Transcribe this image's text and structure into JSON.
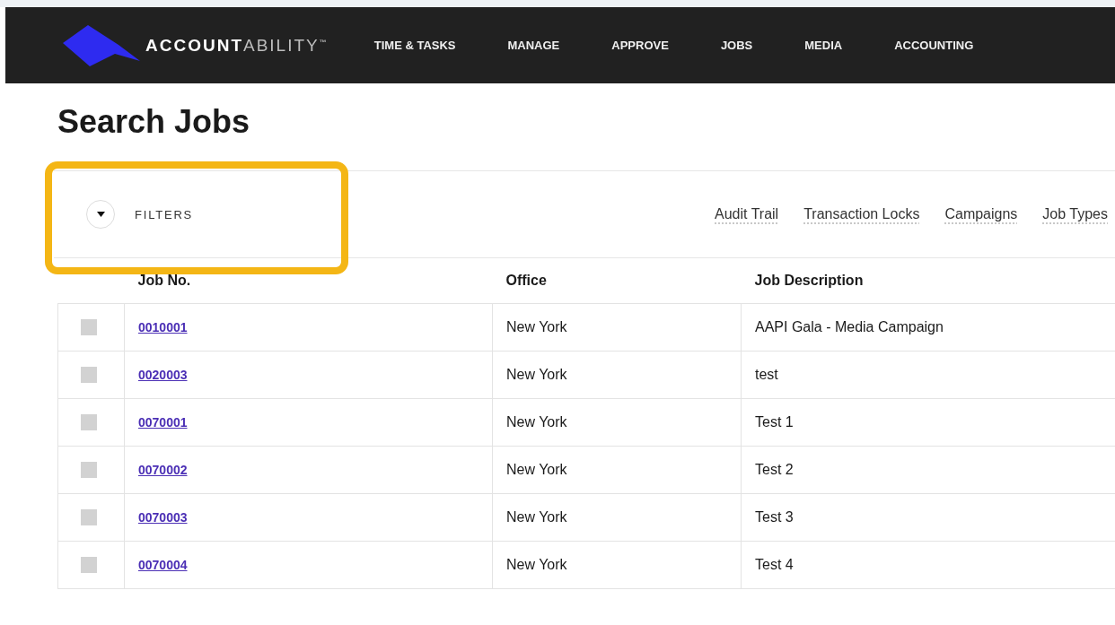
{
  "brand": {
    "strong": "ACCOUNT",
    "light": "ABILITY",
    "mark": "™"
  },
  "nav": [
    {
      "label": "TIME & TASKS"
    },
    {
      "label": "MANAGE"
    },
    {
      "label": "APPROVE"
    },
    {
      "label": "JOBS"
    },
    {
      "label": "MEDIA"
    },
    {
      "label": "ACCOUNTING"
    }
  ],
  "title": "Search Jobs",
  "filters": {
    "label": "FILTERS",
    "expanded": false,
    "highlighted": true
  },
  "links": [
    "Audit Trail",
    "Transaction Locks",
    "Campaigns",
    "Job Types"
  ],
  "table": {
    "columns": [
      "Job No.",
      "Office",
      "Job Description"
    ],
    "rows": [
      {
        "checked": false,
        "job_no": "0010001",
        "office": "New York",
        "description": "AAPI Gala - Media Campaign"
      },
      {
        "checked": false,
        "job_no": "0020003",
        "office": "New York",
        "description": "test"
      },
      {
        "checked": false,
        "job_no": "0070001",
        "office": "New York",
        "description": "Test 1"
      },
      {
        "checked": false,
        "job_no": "0070002",
        "office": "New York",
        "description": "Test 2"
      },
      {
        "checked": false,
        "job_no": "0070003",
        "office": "New York",
        "description": "Test 3"
      },
      {
        "checked": false,
        "job_no": "0070004",
        "office": "New York",
        "description": "Test 4"
      }
    ]
  }
}
